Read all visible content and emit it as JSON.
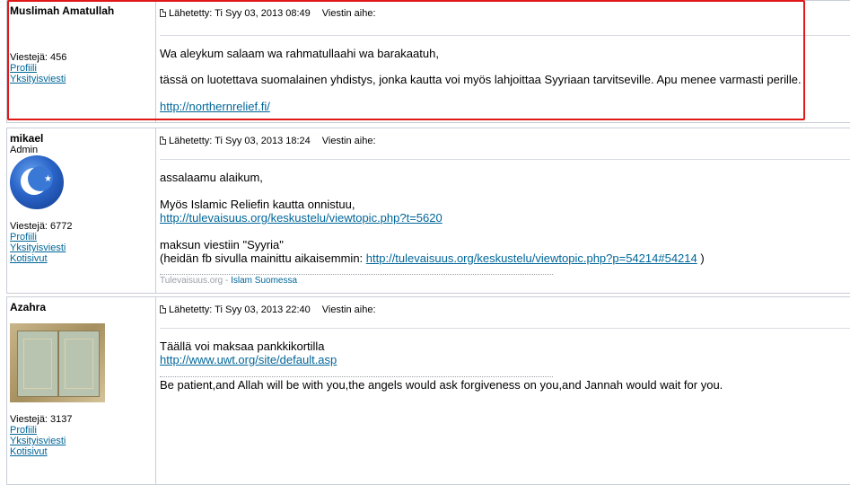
{
  "posts": [
    {
      "author": "Muslimah Amatullah",
      "rank": "",
      "post_count": "Viestejä: 456",
      "links": [
        "Profiili",
        "Yksityisviesti"
      ],
      "posted": "Lähetetty: Ti Syy 03, 2013 08:49",
      "subject": "Viestin aihe:",
      "lines": [
        "Wa aleykum salaam wa rahmatullaahi wa barakaatuh,",
        "tässä on luotettava suomalainen yhdistys, jonka kautta voi myös lahjoittaa Syyriaan tarvitseville. Apu menee varmasti perille.",
        "http://northernrelief.fi/"
      ]
    },
    {
      "author": "mikael",
      "rank": "Admin",
      "avatar": "crescent-star-icon",
      "post_count": "Viestejä: 6772",
      "links": [
        "Profiili",
        "Yksityisviesti",
        "Kotisivut"
      ],
      "posted": "Lähetetty: Ti Syy 03, 2013 18:24",
      "subject": "Viestin aihe:",
      "lines": [
        "assalaamu alaikum,",
        "Myös Islamic Reliefin kautta onnistuu,",
        "http://tulevaisuus.org/keskustelu/viewtopic.php?t=5620",
        "maksun viestiin \"Syyria\"",
        "(heidän fb sivulla mainittu aikaisemmin:",
        "http://tulevaisuus.org/keskustelu/viewtopic.php?p=54214#54214",
        ")"
      ],
      "signature": {
        "site": "Tulevaisuus.org",
        "dash": " - ",
        "link": "Islam Suomessa"
      }
    },
    {
      "author": "Azahra",
      "rank": "",
      "avatar": "book-image",
      "post_count": "Viestejä: 3137",
      "links": [
        "Profiili",
        "Yksityisviesti",
        "Kotisivut"
      ],
      "posted": "Lähetetty: Ti Syy 03, 2013 22:40",
      "subject": "Viestin aihe:",
      "lines": [
        "Täällä voi maksaa pankkikortilla",
        "http://www.uwt.org/site/default.asp",
        "Be patient,and Allah will be with you,the angels would ask forgiveness on you,and Jannah would wait for you."
      ]
    }
  ],
  "colors": {
    "link": "#006699",
    "highlight": "#e01818",
    "border": "#c9cdd6"
  }
}
